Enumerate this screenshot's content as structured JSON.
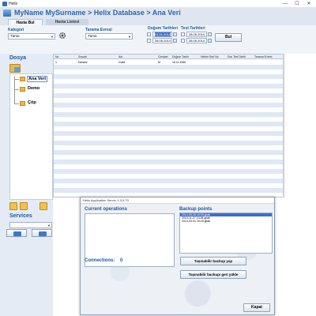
{
  "window": {
    "title": "Helix",
    "minimize": "—",
    "maximize": "☐",
    "close": "✕"
  },
  "breadcrumb": "MyName MySurname > Helix Database > Ana Veri",
  "tabs": [
    {
      "label": "Hasta Bul",
      "active": true
    },
    {
      "label": "Hasta Listesi",
      "active": false
    }
  ],
  "filters": {
    "kategori_label": "Kategori",
    "kategori_value": "Tümü",
    "tarama_label": "Tarama Evresi",
    "tarama_value": "Tümü",
    "dogum_label": "Doğum Tarihleri",
    "dogum_from": "01.01.2014",
    "dogum_to": "28.05.2014",
    "test_label": "Test Tarihleri",
    "test_from": "28.05.2014",
    "test_to": "28.05.2014",
    "search_button": "Bul"
  },
  "sidebar": {
    "dosya_label": "Dosya",
    "tree": [
      {
        "label": "Ana Veri",
        "selected": true
      },
      {
        "label": "Demo",
        "selected": false
      },
      {
        "label": "Çöp",
        "selected": false
      }
    ],
    "services_label": "Services",
    "services_value": ""
  },
  "grid": {
    "columns": [
      "No",
      "Soyadı",
      "Adı",
      "Cinsiyet",
      "Doğum Tarihi",
      "Hekim Seri No",
      "Son Test Tarihi",
      "Tarama Evresi"
    ],
    "rows": [
      [
        "1",
        "Dehelix",
        "Gulbi",
        "M",
        "16.11.1960",
        "",
        "",
        ""
      ]
    ]
  },
  "dialog": {
    "title": "Helix Application Server 1.0.0.70",
    "current_operations_label": "Current operations",
    "backup_points_label": "Backup points",
    "backup_points": [
      {
        "label": "2014-05-28 16:09.gbak",
        "selected": true
      },
      {
        "label": "2013-11-27 13:28.gbak",
        "selected": false
      },
      {
        "label": "2013-03-01 15:29.gbak",
        "selected": false
      }
    ],
    "connections_label": "Connections:",
    "connections_value": "0",
    "backup_button": "Taşınabilir backup yap",
    "restore_button": "Taşınabilir backupı geri yükle",
    "close_button": "Kapat"
  },
  "colors": {
    "accent": "#1c56a3",
    "selection": "#3b6fd0",
    "row_alt": "#dfe8f5"
  }
}
